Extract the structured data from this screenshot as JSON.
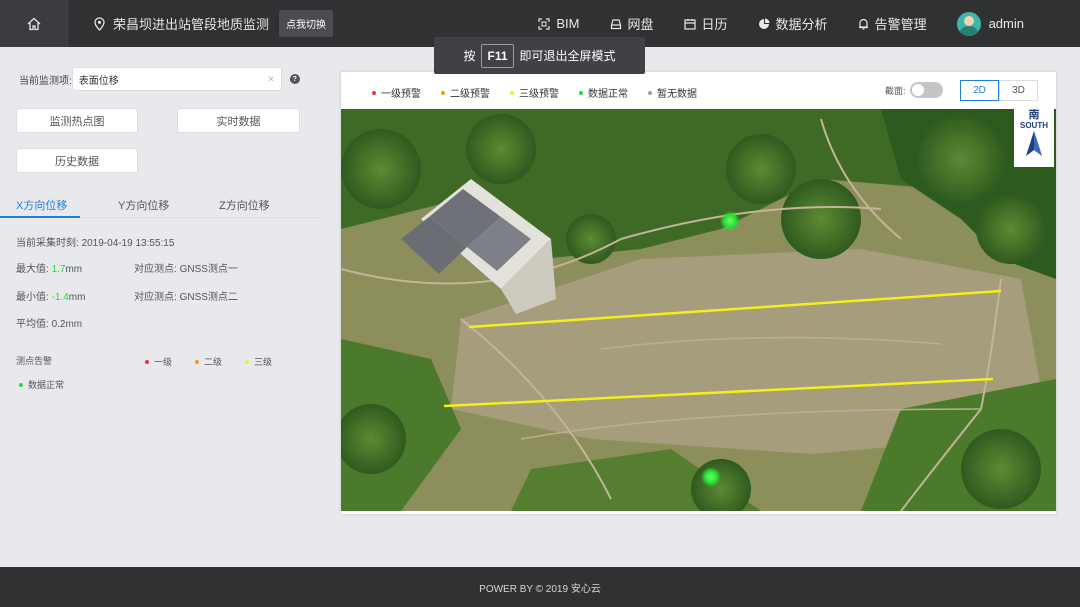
{
  "header": {
    "location": "荣昌坝进出站管段地质监测",
    "switch_label": "点我切换",
    "nav": [
      {
        "label": "BIM",
        "icon": "bim-icon"
      },
      {
        "label": "网盘",
        "icon": "drive-icon"
      },
      {
        "label": "日历",
        "icon": "calendar-icon"
      },
      {
        "label": "数据分析",
        "icon": "pie-chart-icon"
      },
      {
        "label": "告警管理",
        "icon": "bell-icon"
      }
    ],
    "user": "admin"
  },
  "tooltip": {
    "before": "按",
    "key": "F11",
    "after": "即可退出全屏模式"
  },
  "panel": {
    "monitor_label": "当前监测项:",
    "monitor_value": "表面位移",
    "buttons": [
      "监测热点图",
      "实时数据",
      "历史数据"
    ],
    "tabs": [
      "X方向位移",
      "Y方向位移",
      "Z方向位移"
    ],
    "collect_time_label": "当前采集时刻:",
    "collect_time": "2019-04-19 13:55:15",
    "max_label": "最大值:",
    "max_value": "1.7",
    "max_unit": "mm",
    "max_point_label": "对应测点:",
    "max_point": "GNSS测点一",
    "min_label": "最小值:",
    "min_value": "-1.4",
    "min_unit": "mm",
    "min_point_label": "对应测点:",
    "min_point": "GNSS测点二",
    "avg_label": "平均值:",
    "avg_value": "0.2mm",
    "alarm_label": "测点告警",
    "alarm_levels": [
      {
        "label": "一级",
        "color": "#e53935"
      },
      {
        "label": "二级",
        "color": "#f39c12"
      },
      {
        "label": "三级",
        "color": "#f2ea2c"
      },
      {
        "label": "数据正常",
        "color": "#2fd33a"
      }
    ]
  },
  "map": {
    "legend": [
      {
        "label": "一级预警",
        "color": "#e53935"
      },
      {
        "label": "二级预警",
        "color": "#f39c12"
      },
      {
        "label": "三级预警",
        "color": "#f2ea2c"
      },
      {
        "label": "数据正常",
        "color": "#2fd33a"
      },
      {
        "label": "暂无数据",
        "color": "#9e9e9e"
      }
    ],
    "section_label": "截面:",
    "view_2d": "2D",
    "view_3d": "3D",
    "compass_cn": "南",
    "compass_en": "SOUTH"
  },
  "footer": {
    "text": "POWER BY © 2019 安心云"
  }
}
